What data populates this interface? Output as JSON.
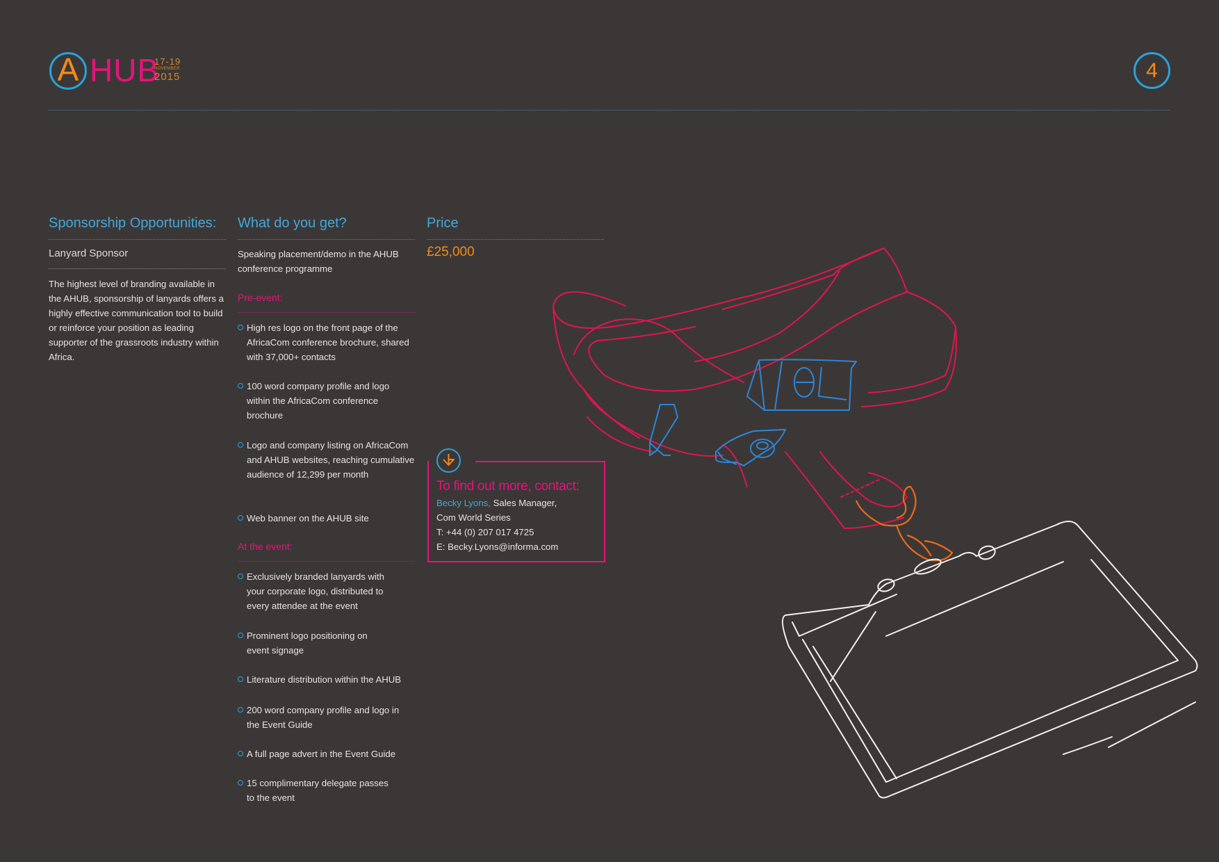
{
  "header": {
    "logo": {
      "letter": "A",
      "name": "HUB",
      "date_days": "17-19",
      "date_month": "NOVEMBER",
      "date_year": "2015"
    },
    "page_number": "4"
  },
  "colors": {
    "background": "#3c3737",
    "blue": "#29a3dc",
    "pink": "#e4147b",
    "orange": "#f28c1a",
    "text": "#e7e4e2"
  },
  "sponsorship": {
    "heading": "Sponsorship Opportunities:",
    "package_name": "Lanyard Sponsor",
    "description": "The highest level of branding available in the AHUB, sponsorship of lanyards offers a highly effective communication tool to build or reinforce your position as leading supporter of the grassroots industry within Africa."
  },
  "benefits": {
    "heading": "What do you get?",
    "intro": "Speaking placement/demo in the AHUB conference programme",
    "pre_event": {
      "heading": "Pre-event:",
      "items": [
        "High res logo on the front page of the AfricaCom conference brochure, shared with 37,000+ contacts",
        "100 word company profile and logo within the AfricaCom conference brochure",
        "Logo and company listing on AfricaCom and AHUB websites, reaching cumulative audience of 12,299 per month",
        "Web banner on the AHUB site"
      ]
    },
    "at_event": {
      "heading": "At the event:",
      "items": [
        "Exclusively branded lanyards with your corporate logo, distributed to every attendee at the event",
        "Prominent logo positioning on event signage",
        "Literature distribution within the AHUB",
        "200 word company profile and logo in the Event Guide",
        "A full page advert in the Event Guide",
        "15 complimentary delegate passes to the event"
      ]
    }
  },
  "price": {
    "heading": "Price",
    "value": "£25,000"
  },
  "contact": {
    "heading": "To find out more, contact:",
    "name": "Becky Lyons,",
    "role": " Sales Manager,",
    "company": "Com World Series",
    "phone": "T: +44 (0) 207 017 4725",
    "email": "E: Becky.Lyons@informa.com"
  }
}
